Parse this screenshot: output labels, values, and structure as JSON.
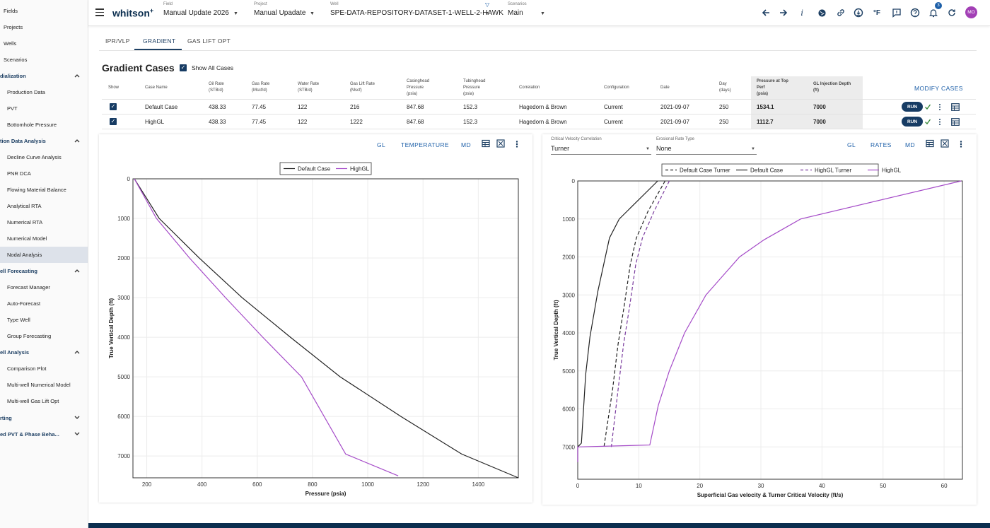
{
  "sidebar": {
    "items": [
      {
        "label": "Fields",
        "kind": "top",
        "y": 4
      },
      {
        "label": "Projects",
        "kind": "top",
        "y": 27
      },
      {
        "label": "Wells",
        "kind": "top",
        "y": 50
      },
      {
        "label": "Scenarios",
        "kind": "top",
        "y": 73
      },
      {
        "label": "dialization",
        "kind": "sec",
        "y": 96,
        "chev": "up"
      },
      {
        "label": "Production Data",
        "kind": "sub",
        "y": 119
      },
      {
        "label": "PVT",
        "kind": "sub",
        "y": 142
      },
      {
        "label": "Bottomhole Pressure",
        "kind": "sub",
        "y": 165
      },
      {
        "label": "tion Data Analysis",
        "kind": "sec",
        "y": 188,
        "chev": "up"
      },
      {
        "label": "Decline Curve Analysis",
        "kind": "sub",
        "y": 211
      },
      {
        "label": "PNR DCA",
        "kind": "sub",
        "y": 234
      },
      {
        "label": "Flowing Material Balance",
        "kind": "sub",
        "y": 257
      },
      {
        "label": "Analytical RTA",
        "kind": "sub",
        "y": 280
      },
      {
        "label": "Numerical RTA",
        "kind": "sub",
        "y": 303
      },
      {
        "label": "Numerical Model",
        "kind": "sub",
        "y": 326
      },
      {
        "label": "Nodal Analysis",
        "kind": "sub",
        "y": 349,
        "active": true
      },
      {
        "label": "ell Forecasting",
        "kind": "sec",
        "y": 372,
        "chev": "up"
      },
      {
        "label": "Forecast Manager",
        "kind": "sub",
        "y": 395
      },
      {
        "label": "Auto-Forecast",
        "kind": "sub",
        "y": 418
      },
      {
        "label": "Type Well",
        "kind": "sub",
        "y": 441
      },
      {
        "label": "Group Forecasting",
        "kind": "sub",
        "y": 464
      },
      {
        "label": "ell Analysis",
        "kind": "sec",
        "y": 487,
        "chev": "up"
      },
      {
        "label": "Comparison Plot",
        "kind": "sub",
        "y": 510
      },
      {
        "label": "Multi-well Numerical Model",
        "kind": "sub",
        "y": 533
      },
      {
        "label": "Multi-well Gas Lift Opt",
        "kind": "sub",
        "y": 556
      },
      {
        "label": "rting",
        "kind": "sec",
        "y": 580,
        "chev": "down"
      },
      {
        "label": "ed PVT & Phase Beha...",
        "kind": "sec",
        "y": 603,
        "chev": "down"
      }
    ]
  },
  "header": {
    "logo": "whitson",
    "logo_sup": "+",
    "field": {
      "label": "Field",
      "value": "Manual Update 2026"
    },
    "project": {
      "label": "Project",
      "value": "Manual Upadate"
    },
    "well": {
      "label": "Well",
      "value": "SPE-DATA-REPOSITORY-DATASET-1-WELL-2-HAWK"
    },
    "scenarios": {
      "label": "Scenarios",
      "value": "Main"
    },
    "notification_count": "3",
    "avatar_initials": "MO",
    "icons": [
      "arrow-left-icon",
      "arrow-right-icon",
      "info-icon",
      "globe-icon",
      "link-icon",
      "download-icon",
      "fahrenheit-icon",
      "feedback-icon",
      "help-icon",
      "bell-icon",
      "refresh-icon"
    ],
    "temp_unit": "°F",
    "info_glyph": "i"
  },
  "tabs": [
    {
      "label": "IPR/VLP"
    },
    {
      "label": "GRADIENT",
      "active": true
    },
    {
      "label": "GAS LIFT OPT"
    }
  ],
  "gradient_cases": {
    "title": "Gradient Cases",
    "show_all_label": "Show All Cases",
    "modify_label": "MODIFY CASES",
    "run_label": "RUN",
    "columns": [
      {
        "key": "show",
        "label": "Show"
      },
      {
        "key": "name",
        "label": "Case Name"
      },
      {
        "key": "oil",
        "label": "Oil Rate\n(STB/d)"
      },
      {
        "key": "gas",
        "label": "Gas Rate\n(Mscf/d)"
      },
      {
        "key": "water",
        "label": "Water Rate\n(STB/d)"
      },
      {
        "key": "gaslift",
        "label": "Gas Lift Rate\n(Mscf)"
      },
      {
        "key": "chp",
        "label": "Casinghead\nPressure\n(psia)"
      },
      {
        "key": "thp",
        "label": "Tubinghead\nPressure\n(psia)"
      },
      {
        "key": "corr",
        "label": "Correlation"
      },
      {
        "key": "config",
        "label": "Configuration"
      },
      {
        "key": "date",
        "label": "Date"
      },
      {
        "key": "day",
        "label": "Day\n(days)"
      },
      {
        "key": "ptop",
        "label": "Pressure at Top\nPerf\n(psia)"
      },
      {
        "key": "gldepth",
        "label": "GL Injection Depth\n(ft)"
      }
    ],
    "rows": [
      {
        "name": "Default Case",
        "oil": "438.33",
        "gas": "77.45",
        "water": "122",
        "gaslift": "216",
        "chp": "847.68",
        "thp": "152.3",
        "corr": "Hagedorn & Brown",
        "config": "Current",
        "date": "2021-09-07",
        "day": "250",
        "ptop": "1534.1",
        "gldepth": "7000"
      },
      {
        "name": "HighGL",
        "oil": "438.33",
        "gas": "77.45",
        "water": "122",
        "gaslift": "1222",
        "chp": "847.68",
        "thp": "152.3",
        "corr": "Hagedorn & Brown",
        "config": "Current",
        "date": "2021-09-07",
        "day": "250",
        "ptop": "1112.7",
        "gldepth": "7000"
      }
    ]
  },
  "left_card": {
    "buttons": [
      "GL",
      "TEMPERATURE",
      "MD"
    ]
  },
  "right_card": {
    "buttons": [
      "GL",
      "RATES",
      "MD"
    ],
    "critical_velocity": {
      "label": "Critical Velocity Correlation",
      "value": "Turner"
    },
    "erosional": {
      "label": "Erosional Rate Type",
      "value": "None"
    }
  },
  "colors": {
    "navy": "#163b63",
    "accent": "#1d5fa8",
    "default_case": "#222222",
    "highgl": "#a54bc8"
  },
  "chart_data": [
    {
      "type": "line",
      "xlabel": "Pressure (psia)",
      "ylabel": "True Vertical Depth (ft)",
      "xlim": [
        150,
        1545
      ],
      "ylim": [
        7550,
        0
      ],
      "xticks": [
        200,
        400,
        600,
        800,
        1000,
        1200,
        1400
      ],
      "yticks": [
        0,
        1000,
        2000,
        3000,
        4000,
        5000,
        6000,
        7000
      ],
      "grid": true,
      "legend": "top-center",
      "series": [
        {
          "name": "Default Case",
          "style": "solid",
          "color": "#222222",
          "x": [
            155,
            245,
            390,
            545,
            720,
            900,
            1120,
            1340,
            1545
          ],
          "y": [
            0,
            1000,
            2000,
            3000,
            4000,
            5000,
            6000,
            6950,
            7550
          ]
        },
        {
          "name": "HighGL",
          "style": "solid",
          "color": "#a54bc8",
          "x": [
            155,
            235,
            355,
            485,
            620,
            760,
            920,
            1110
          ],
          "y": [
            0,
            1000,
            2000,
            3000,
            4000,
            5000,
            6950,
            7500
          ]
        }
      ]
    },
    {
      "type": "line",
      "xlabel": "Superficial Gas velocity & Turner Critical Velocity (ft/s)",
      "ylabel": "True Vertical Depth (ft)",
      "xlim": [
        0,
        63
      ],
      "ylim": [
        7850,
        0
      ],
      "xticks": [
        0,
        10,
        20,
        30,
        40,
        50,
        60
      ],
      "yticks": [
        0,
        1000,
        2000,
        3000,
        4000,
        5000,
        6000,
        7000
      ],
      "grid": true,
      "legend": "top-center",
      "series": [
        {
          "name": "Default Case Turner",
          "style": "dashed",
          "color": "#222222",
          "x": [
            14.3,
            11.5,
            9.6,
            8.6,
            7.6,
            6.6,
            5.7,
            4.3
          ],
          "y": [
            0,
            800,
            1500,
            2200,
            3300,
            4300,
            5500,
            7000
          ]
        },
        {
          "name": "Default Case",
          "style": "solid",
          "color": "#222222",
          "x": [
            13.1,
            6.8,
            5.2,
            3.3,
            2.0,
            1.3,
            0.6,
            0.0,
            0.0
          ],
          "y": [
            0,
            1000,
            1500,
            2900,
            4100,
            5100,
            6900,
            7000,
            7400
          ]
        },
        {
          "name": "HighGL Turner",
          "style": "dashed",
          "color": "#7a3c9e",
          "x": [
            15.0,
            12.5,
            10.6,
            9.5,
            8.5,
            7.5,
            6.6,
            5.5
          ],
          "y": [
            0,
            800,
            1500,
            2200,
            3300,
            4300,
            5500,
            7000
          ]
        },
        {
          "name": "HighGL",
          "style": "solid",
          "color": "#a54bc8",
          "x": [
            62.8,
            36.5,
            30.5,
            26.5,
            21,
            17.5,
            15,
            13.2,
            11.8,
            0.0,
            0.0
          ],
          "y": [
            0,
            1000,
            1550,
            2000,
            3000,
            4000,
            5000,
            5900,
            6950,
            7000,
            7400
          ]
        }
      ]
    }
  ]
}
